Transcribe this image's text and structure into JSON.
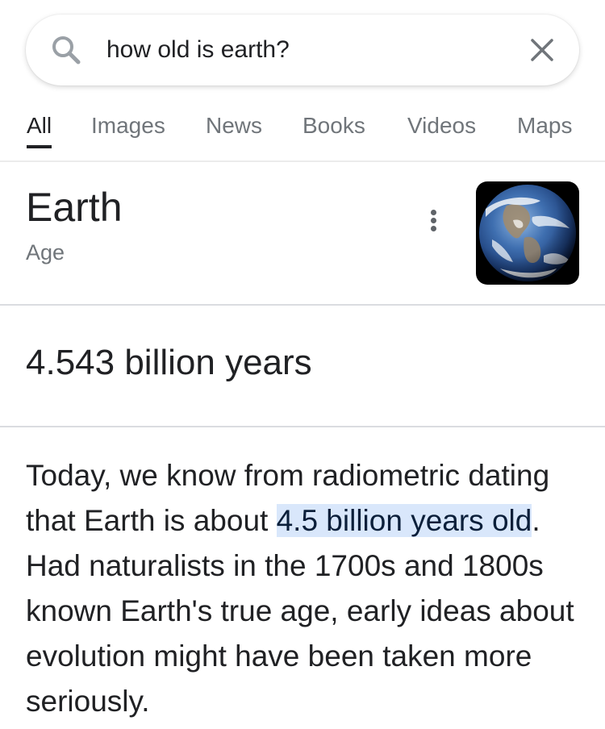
{
  "search": {
    "query": "how old is earth?",
    "icon": "search-icon",
    "clear_icon": "close-icon"
  },
  "tabs": [
    {
      "label": "All",
      "active": true
    },
    {
      "label": "Images",
      "active": false
    },
    {
      "label": "News",
      "active": false
    },
    {
      "label": "Books",
      "active": false
    },
    {
      "label": "Videos",
      "active": false
    },
    {
      "label": "Maps",
      "active": false
    }
  ],
  "entity": {
    "title": "Earth",
    "subtitle": "Age",
    "more_icon": "more-vert-icon",
    "image": "earth-globe-thumbnail"
  },
  "answer": {
    "value": "4.543 billion years"
  },
  "description": {
    "before": "Today, we know from radiometric dating that Earth is about ",
    "highlight": "4.5 billion years old",
    "after": ". Had naturalists in the 1700s and 1800s known Earth's true age, early ideas about evolution might have been taken more seriously."
  },
  "colors": {
    "text_primary": "#202124",
    "text_secondary": "#70757a",
    "highlight_bg": "#d9e7fb",
    "divider": "#dadce0"
  }
}
